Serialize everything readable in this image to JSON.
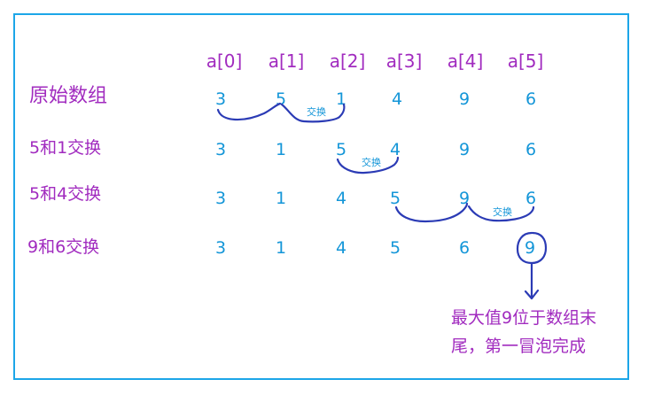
{
  "headers": [
    "a[0]",
    "a[1]",
    "a[2]",
    "a[3]",
    "a[4]",
    "a[5]"
  ],
  "rows": [
    {
      "label": "原始数组",
      "values": [
        "3",
        "5",
        "1",
        "4",
        "9",
        "6"
      ]
    },
    {
      "label": "5和1交换",
      "values": [
        "3",
        "1",
        "5",
        "4",
        "9",
        "6"
      ]
    },
    {
      "label": "5和4交换",
      "values": [
        "3",
        "1",
        "4",
        "5",
        "9",
        "6"
      ]
    },
    {
      "label": "9和6交换",
      "values": [
        "3",
        "1",
        "4",
        "5",
        "6",
        "9"
      ]
    }
  ],
  "swap_labels": [
    "交换",
    "交换",
    "交换"
  ],
  "note_lines": [
    "最大值9位于数组末",
    "尾，第一冒泡完成"
  ],
  "colors": {
    "frame": "#1ca6e8",
    "label_purple": "#a12bbf",
    "value_blue": "#1496d8",
    "ink": "#2b3bb5"
  }
}
